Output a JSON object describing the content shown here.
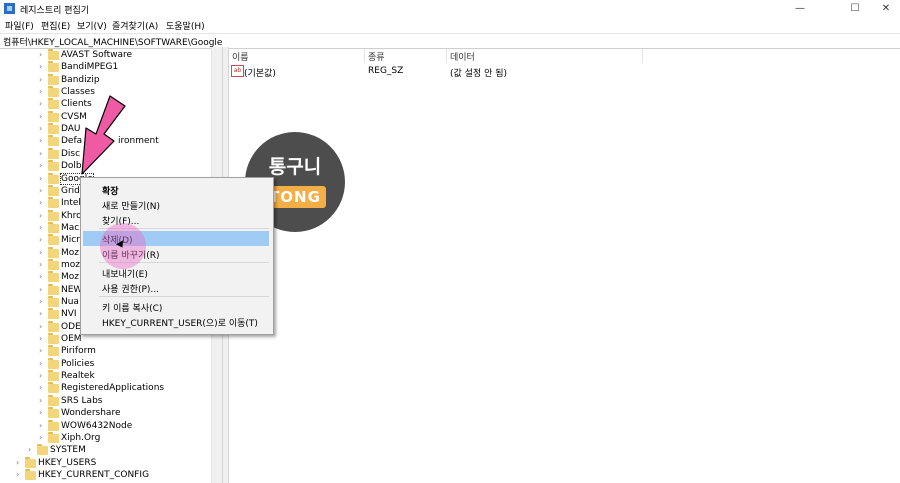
{
  "window": {
    "title": "레지스트리 편집기",
    "buttons": {
      "minimize": "—",
      "maximize": "☐",
      "close": "✕"
    }
  },
  "menu": [
    "파일(F)",
    "편집(E)",
    "보기(V)",
    "즐겨찾기(A)",
    "도움말(H)"
  ],
  "address": "컴퓨터\\HKEY_LOCAL_MACHINE\\SOFTWARE\\Google",
  "tree": {
    "children": [
      "AVAST Software",
      "BandiMPEG1",
      "Bandizip",
      "Classes",
      "Clients",
      "CVSM",
      "DAUM",
      "DefaultUserEnvironment",
      "Disc",
      "Dolby",
      "Google",
      "Grid",
      "Intel",
      "Khronos",
      "Macromedia",
      "Microsoft",
      "Mozilla",
      "mozilla.org",
      "MozillaPlugins",
      "NEW",
      "Nuance",
      "NVIDIA",
      "ODBC",
      "OEM",
      "Piriform",
      "Policies",
      "Realtek",
      "RegisteredApplications",
      "SRS Labs",
      "Wondershare",
      "WOW6432Node",
      "Xiph.Org"
    ],
    "visible_labels": [
      "AVAST Software",
      "BandiMPEG1",
      "Bandizip",
      "Classes",
      "Clients",
      "CVSM",
      "DAU",
      "Defa",
      "Disc",
      "Dolb",
      "Google",
      "Grid",
      "Intel",
      "Khro",
      "Mac",
      "Micr",
      "Moz",
      "moz",
      "Moz",
      "NEW",
      "Nua",
      "NVI",
      "ODE",
      "OEM",
      "Piriform",
      "Policies",
      "Realtek",
      "RegisteredApplications",
      "SRS Labs",
      "Wondershare",
      "WOW6432Node",
      "Xiph.Org"
    ],
    "default_env_suffix": "ironment",
    "selected": "Google",
    "roots": [
      "SYSTEM",
      "HKEY_USERS",
      "HKEY_CURRENT_CONFIG"
    ]
  },
  "list": {
    "columns": [
      "이름",
      "종류",
      "데이터"
    ],
    "rows": [
      {
        "name": "(기본값)",
        "type": "REG_SZ",
        "data": "(값 설정 안 됨)",
        "icon": "ab"
      }
    ]
  },
  "context_menu": {
    "items": [
      {
        "label": "확장",
        "bold": true
      },
      {
        "label": "새로 만들기(N)"
      },
      {
        "label": "찾기(F)..."
      },
      {
        "separator": true
      },
      {
        "label": "삭제(D)",
        "hover": true
      },
      {
        "label": "이름 바꾸기(R)"
      },
      {
        "separator": true
      },
      {
        "label": "내보내기(E)"
      },
      {
        "label": "사용 권한(P)..."
      },
      {
        "separator": true
      },
      {
        "label": "키 이름 복사(C)"
      },
      {
        "label": "HKEY_CURRENT_USER(으)로 이동(T)"
      }
    ]
  },
  "watermark": {
    "title": "통구니",
    "tag": "TONG"
  },
  "colors": {
    "pink_arrow": "#ee5aa3",
    "hover": "#9fcbf5",
    "watermark_bg": "#4d4d4d",
    "watermark_tag": "#f4ae46",
    "folder": "#f3d67c"
  }
}
